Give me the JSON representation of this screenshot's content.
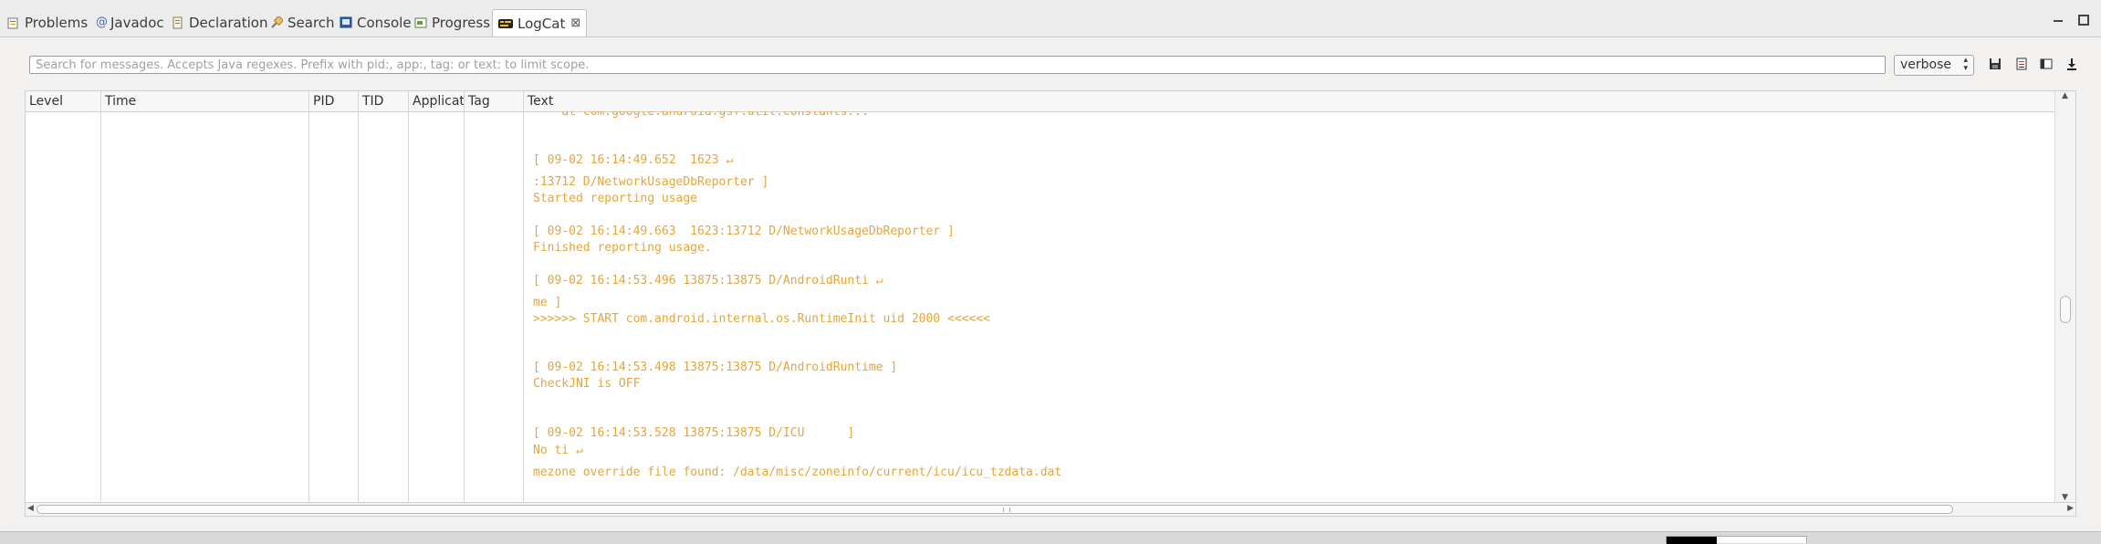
{
  "tabs": [
    {
      "label": "Problems",
      "icon": "problems-icon"
    },
    {
      "label": "Javadoc",
      "icon": "javadoc-icon"
    },
    {
      "label": "Declaration",
      "icon": "declaration-icon"
    },
    {
      "label": "Search",
      "icon": "search-icon"
    },
    {
      "label": "Console",
      "icon": "console-icon"
    },
    {
      "label": "Progress",
      "icon": "progress-icon"
    },
    {
      "label": "LogCat",
      "icon": "logcat-icon",
      "active": true
    }
  ],
  "search": {
    "placeholder": "Search for messages. Accepts Java regexes. Prefix with pid:, app:, tag: or text: to limit scope.",
    "value": ""
  },
  "log_level": {
    "selected": "verbose"
  },
  "toolbar_icons": [
    "save-icon",
    "clear-log-icon",
    "toggle-columns-icon",
    "scroll-lock-icon"
  ],
  "columns": [
    "Level",
    "Time",
    "PID",
    "TID",
    "Applicat",
    "Tag",
    "Text"
  ],
  "log_lines": [
    "    at com.google.android.gsf.util.Constants...",
    "[ 09-02 16:14:49.652  1623 ↵",
    ":13712 D/NetworkUsageDbReporter ]",
    "Started reporting usage",
    "[ 09-02 16:14:49.663  1623:13712 D/NetworkUsageDbReporter ]",
    "Finished reporting usage.",
    "[ 09-02 16:14:53.496 13875:13875 D/AndroidRunti ↵",
    "me ]",
    ">>>>>> START com.android.internal.os.RuntimeInit uid 2000 <<<<<<",
    "[ 09-02 16:14:53.498 13875:13875 D/AndroidRuntime ]",
    "CheckJNI is OFF",
    "[ 09-02 16:14:53.528 13875:13875 D/ICU      ]",
    "No ti ↵",
    "mezone override file found: /data/misc/zoneinfo/current/icu/icu_tzdata.dat"
  ],
  "colors": {
    "log_text": "#e4a53c",
    "panel_bg": "#f2f1f0"
  }
}
